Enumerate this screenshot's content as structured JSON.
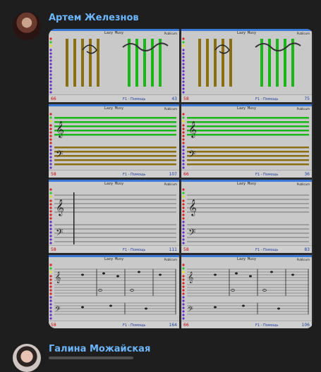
{
  "messages": [
    {
      "author": "Артем Железнов"
    },
    {
      "author": "Галина Можайская"
    }
  ],
  "tiles": [
    {
      "title": "Lazy Musy",
      "corner": "Publicum",
      "left_num": "66",
      "right_num": "43",
      "hint": "F1 - Помощь"
    },
    {
      "title": "Lazy Musy",
      "corner": "Publicum",
      "left_num": "58",
      "right_num": "75",
      "hint": "F1 - Помощь"
    },
    {
      "title": "Lazy Musy",
      "corner": "Publicum",
      "left_num": "58",
      "right_num": "107",
      "hint": "F1 - Помощь"
    },
    {
      "title": "Lazy Musy",
      "corner": "Publicum",
      "left_num": "66",
      "right_num": "36",
      "hint": "F1 - Помощь"
    },
    {
      "title": "Lazy Musy",
      "corner": "Publicum",
      "left_num": "58",
      "right_num": "111",
      "hint": "F1 - Помощь"
    },
    {
      "title": "Lazy Musy",
      "corner": "Publicum",
      "left_num": "58",
      "right_num": "83",
      "hint": "F1 - Помощь"
    },
    {
      "title": "Lazy Musy",
      "corner": "Publicum",
      "left_num": "58",
      "right_num": "164",
      "hint": "F1 - Помощь"
    },
    {
      "title": "Lazy Musy",
      "corner": "Publicum",
      "left_num": "66",
      "right_num": "106",
      "hint": "F1 - Помощь"
    }
  ],
  "colors": {
    "author": "#6cb6ff",
    "olive": "#8b6d12",
    "green": "#19b519",
    "titlebar": "#3a78d8"
  }
}
